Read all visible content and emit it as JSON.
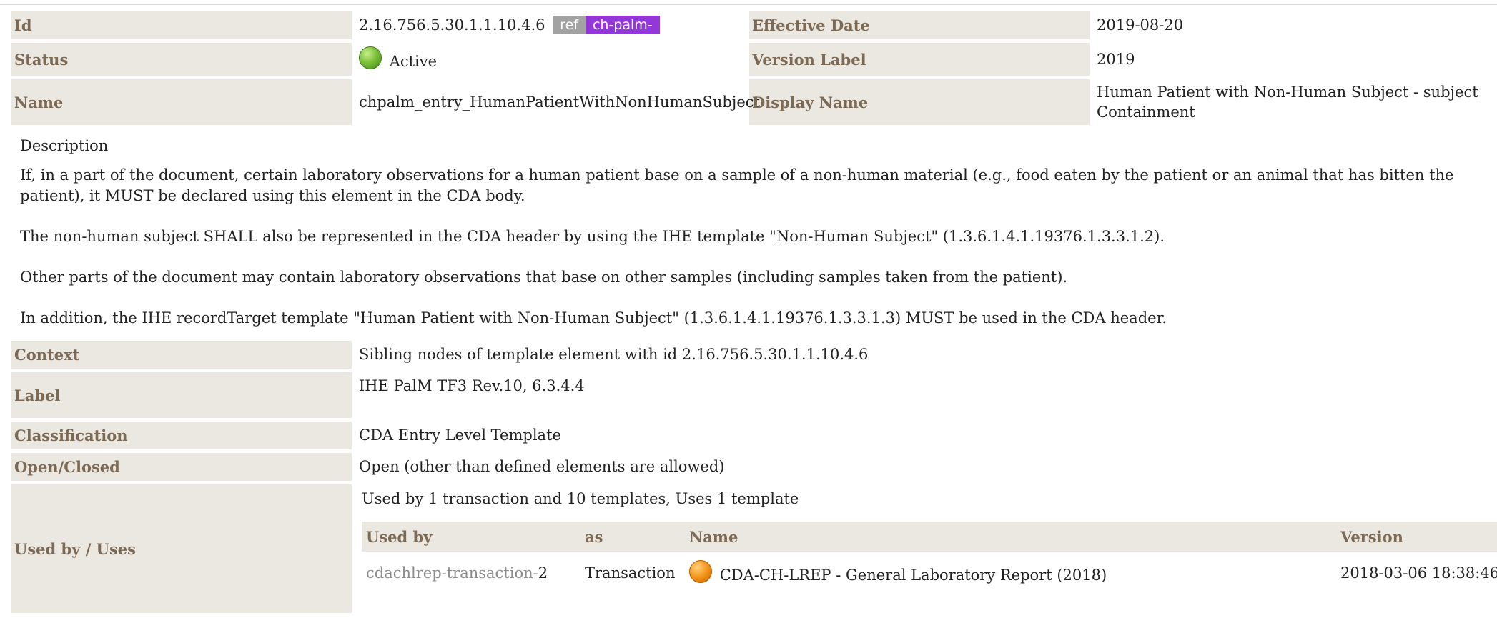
{
  "header": {
    "id_label": "Id",
    "id_value": "2.16.756.5.30.1.1.10.4.6",
    "ref_badge": "ref",
    "prefix_badge": "ch-palm-",
    "effective_date_label": "Effective Date",
    "effective_date_value": "2019-08-20",
    "status_label": "Status",
    "status_value": "Active",
    "version_label_label": "Version Label",
    "version_label_value": "2019",
    "name_label": "Name",
    "name_value": "chpalm_entry_HumanPatientWithNonHumanSubject",
    "display_name_label": "Display Name",
    "display_name_value": "Human Patient with Non-Human Subject - subject Containment"
  },
  "description": {
    "heading": "Description",
    "paragraphs": [
      "If, in a part of the document, certain laboratory observations for a human patient base on a sample of a non-human material (e.g., food eaten by the patient or an animal that has bitten the patient), it MUST be declared using this element in the CDA body.",
      "The non-human subject SHALL also be represented in the CDA header by using the IHE template \"Non-Human Subject\" (1.3.6.1.4.1.19376.1.3.3.1.2).",
      "Other parts of the document may contain laboratory observations that base on other samples (including samples taken from the patient).",
      "In addition, the IHE recordTarget template \"Human Patient with Non-Human Subject\" (1.3.6.1.4.1.19376.1.3.3.1.3) MUST be used in the CDA header."
    ]
  },
  "details": {
    "context_label": "Context",
    "context_value": "Sibling nodes of template element with id 2.16.756.5.30.1.1.10.4.6",
    "label_label": "Label",
    "label_value": "IHE PalM TF3 Rev.10, 6.3.4.4",
    "classification_label": "Classification",
    "classification_value": "CDA Entry Level Template",
    "open_closed_label": "Open/Closed",
    "open_closed_value": "Open (other than defined elements are allowed)"
  },
  "usage": {
    "label": "Used by / Uses",
    "summary": "Used by 1 transaction and 10 templates, Uses 1 template",
    "columns": {
      "used_by": "Used by",
      "as": "as",
      "name": "Name",
      "version": "Version"
    },
    "rows": [
      {
        "used_by_prefix": "cdachlrep-transaction-",
        "used_by_number": "2",
        "as": "Transaction",
        "status_icon": "orange-status-icon",
        "name": "CDA-CH-LREP - General Laboratory Report (2018)",
        "version": "2018-03-06 18:38:46"
      }
    ]
  },
  "colors": {
    "label_bg": "#ebe7e1",
    "label_text": "#7d6a55",
    "ref_badge_bg": "#a2a2a2",
    "prefix_badge_bg": "#9337d8",
    "active_status": "#7cc13a",
    "draft_status": "#f3951a"
  }
}
